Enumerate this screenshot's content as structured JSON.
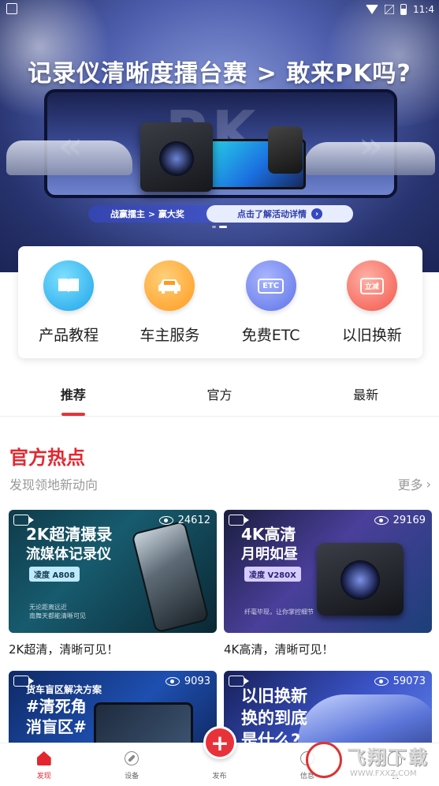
{
  "status_bar": {
    "time": "11:4"
  },
  "banner": {
    "title": "记录仪清晰度擂台赛 > 敢来PK吗?",
    "screen_text": "PK",
    "pill_left": "战赢擂主 > 赢大奖",
    "pill_right": "点击了解活动详情",
    "page_count": 2,
    "active_page": 2
  },
  "services": [
    {
      "label": "产品教程",
      "icon": "book-icon"
    },
    {
      "label": "车主服务",
      "icon": "car-icon"
    },
    {
      "label": "免费ETC",
      "icon": "etc-icon",
      "icon_text": "ETC"
    },
    {
      "label": "以旧换新",
      "icon": "trade-in-icon",
      "icon_text": "立减"
    }
  ],
  "tabs": [
    {
      "label": "推荐",
      "active": true
    },
    {
      "label": "官方",
      "active": false
    },
    {
      "label": "最新",
      "active": false
    }
  ],
  "section": {
    "title": "官方热点",
    "subtitle": "发现领地新动向",
    "more": "更多"
  },
  "cards": [
    {
      "views": "24612",
      "headline_1": "2K超清摄录",
      "headline_2": "流媒体记录仪",
      "tag": "凌度 A808",
      "small_1": "无论距离远近",
      "small_2": "南舞天都能清晰可见",
      "caption": "2K超清，清晰可见！"
    },
    {
      "views": "29169",
      "headline_1": "4K高清",
      "headline_2": "月明如昼",
      "tag": "凌度 V280X",
      "small_1": "纤毫毕现，让你掌控细节",
      "caption": "4K高清，清晰可见！"
    },
    {
      "views": "9093",
      "headline_0": "货车盲区解决方案",
      "headline_1": "#清死角",
      "headline_2": "消盲区#"
    },
    {
      "views": "59073",
      "headline_1": "以旧换新",
      "headline_2": "换的到底",
      "headline_3": "是什么?"
    }
  ],
  "bottom_nav": [
    {
      "label": "发现",
      "icon": "home-icon",
      "active": true
    },
    {
      "label": "设备",
      "icon": "compass-icon",
      "active": false
    },
    {
      "label": "发布",
      "icon": "plus-icon",
      "active": false
    },
    {
      "label": "信息",
      "icon": "message-icon",
      "active": false
    },
    {
      "label": "我",
      "icon": "profile-icon",
      "active": false
    }
  ],
  "publish_symbol": "+",
  "watermark": {
    "title": "飞翔下载",
    "url": "WWW.FXXZ.COM"
  },
  "colors": {
    "accent": "#e3272f",
    "banner_dark": "#27336e"
  }
}
